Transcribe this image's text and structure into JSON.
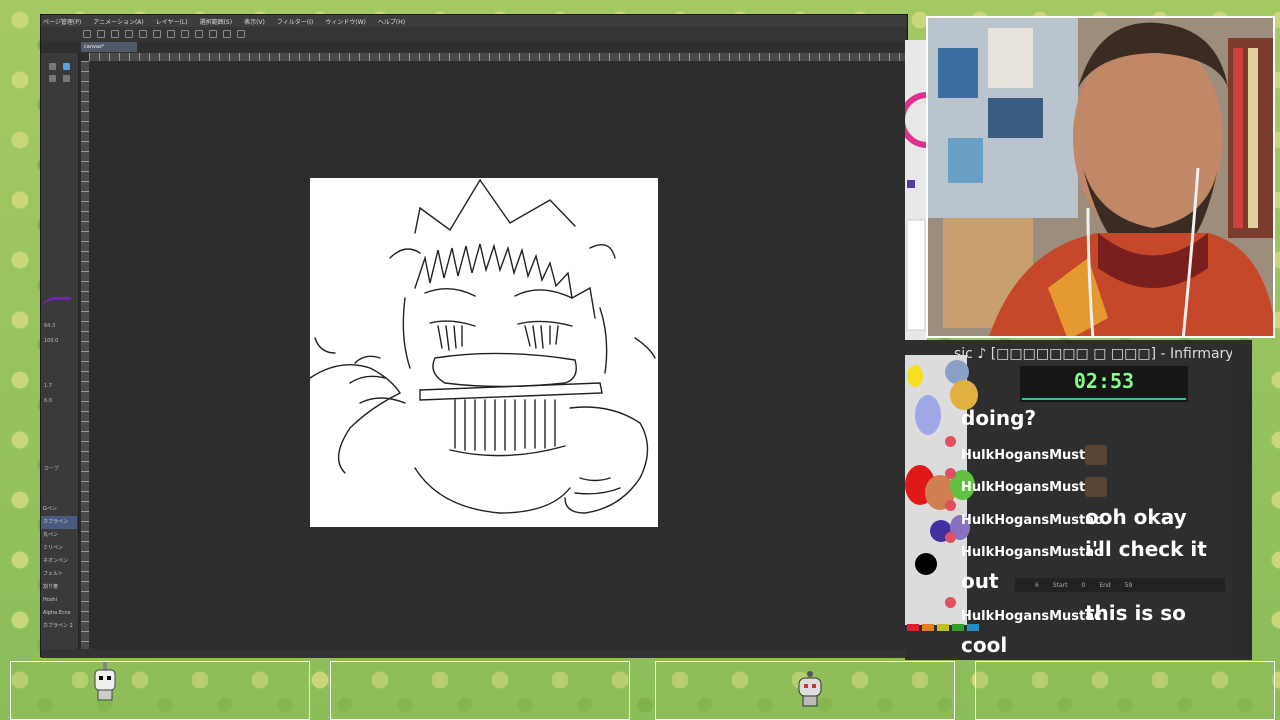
{
  "menu": [
    "ページ管理(P)",
    "アニメーション(A)",
    "レイヤー(L)",
    "選択範囲(S)",
    "表示(V)",
    "フィルター(I)",
    "ウィンドウ(W)",
    "ヘルプ(H)"
  ],
  "tab_label": "canvas*",
  "left_values": [
    "64.3",
    "100.0",
    "1.7",
    "6.0"
  ],
  "brush_items": [
    "Gペン",
    "カブラペン",
    "丸ペン",
    "ミリペン",
    "ネオンペン",
    "フェルト",
    "割り箸",
    "Hoshi",
    "Alpha Ecce",
    "カブラペン 2"
  ],
  "layer_label": "カーブ",
  "bottom_label": "100",
  "now_playing": "sic ♪ [□□□□□□□ □ □□□]  - Infirmary - It's",
  "timer": "02:53",
  "chat": {
    "top_fragment": "doing?",
    "entries": [
      {
        "user": "HulkHogansMustac",
        "message": ""
      },
      {
        "user": "HulkHogansMustac",
        "message": ""
      },
      {
        "user": "HulkHogansMustac",
        "message": "ooh okay"
      },
      {
        "user": "HulkHogansMustac",
        "message": "i'll check it"
      },
      {
        "user": "",
        "message": "out"
      },
      {
        "user": "HulkHogansMustac",
        "message": "this is so"
      },
      {
        "user": "",
        "message": "cool"
      }
    ]
  },
  "timeline": {
    "frame": "6",
    "start_label": "Start",
    "start": "0",
    "end_label": "End",
    "end": "59"
  },
  "colors": {
    "accent_green": "#7fff8a",
    "purple": "#6a28a8"
  }
}
